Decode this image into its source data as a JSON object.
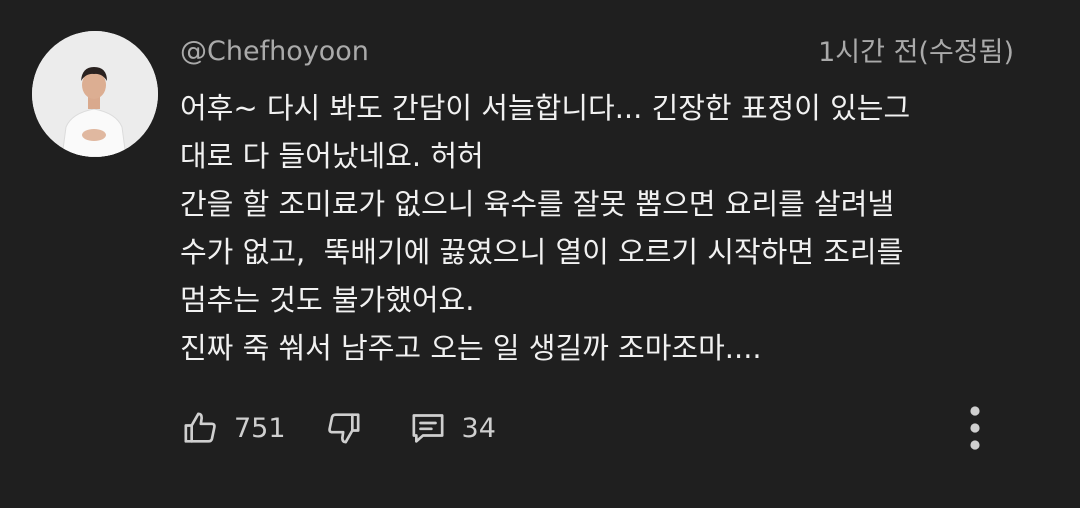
{
  "comment": {
    "author_handle": "@Chefhoyoon",
    "timestamp": "1시간 전(수정됨)",
    "lines": [
      "어후~ 다시 봐도 간담이 서늘합니다... 긴장한 표정이 있는그",
      "대로 다 들어났네요. 허허",
      "간을 할 조미료가 없으니 육수를 잘못 뽑으면 요리를 살려낼",
      "수가 없고,  뚝배기에 끓였으니 열이 오르기 시작하면 조리를",
      "멈추는 것도 불가했어요.",
      "진짜 죽 쒀서 남주고 오는 일 생길까 조마조마...."
    ]
  },
  "actions": {
    "like_count": "751",
    "reply_count": "34"
  },
  "icons": {
    "like": "thumbs-up-icon",
    "dislike": "thumbs-down-icon",
    "reply": "comment-icon",
    "menu": "more-vertical-icon"
  },
  "colors": {
    "background": "#1f1f1f",
    "text": "#f1f1f1",
    "secondary_text": "#aaaaaa"
  }
}
